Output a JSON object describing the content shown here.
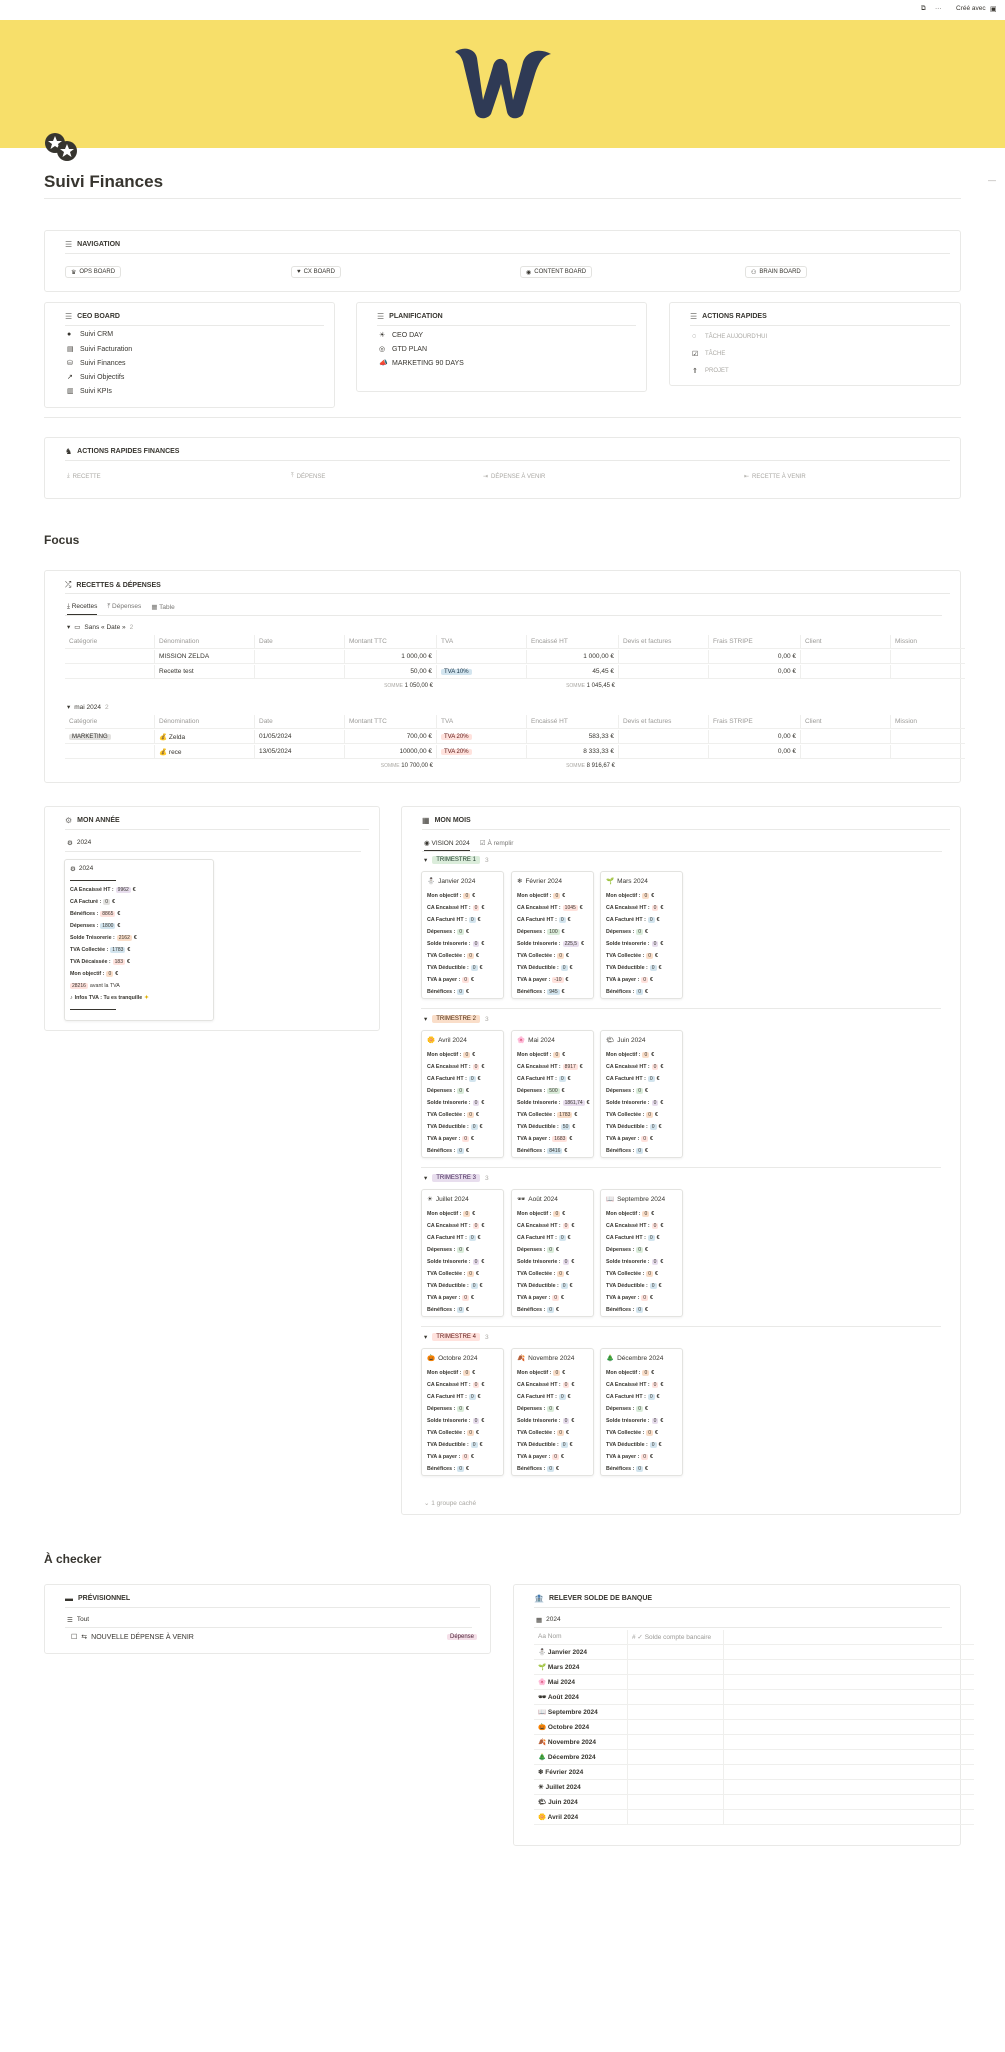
{
  "topbar": {
    "created_with": "Créé avec",
    "more": "···"
  },
  "page": {
    "title": "Suivi Finances"
  },
  "navigation": {
    "title": "NAVIGATION",
    "buttons": [
      {
        "icon": "crown",
        "label": "OPS BOARD"
      },
      {
        "icon": "heart",
        "label": "CX BOARD"
      },
      {
        "icon": "palette",
        "label": "CONTENT BOARD"
      },
      {
        "icon": "brain",
        "label": "BRAIN BOARD"
      }
    ]
  },
  "ceo_board": {
    "title": "CEO BOARD",
    "items": [
      "Suivi CRM",
      "Suivi Facturation",
      "Suivi Finances",
      "Suivi Objectifs",
      "Suivi KPIs"
    ]
  },
  "planification": {
    "title": "PLANIFICATION",
    "items": [
      "CEO DAY",
      "GTD PLAN",
      "MARKETING 90 DAYS"
    ]
  },
  "actions_rapides": {
    "title": "ACTIONS RAPIDES",
    "items": [
      "TÂCHE AUJOURD'HUI",
      "TÂCHE",
      "PROJET"
    ]
  },
  "actions_finances": {
    "title": "ACTIONS RAPIDES FINANCES",
    "items": [
      "RECETTE",
      "DÉPENSE",
      "DÉPENSE À VENIR",
      "RECETTE À VENIR"
    ]
  },
  "focus": {
    "title": "Focus",
    "db_title": "RECETTES & DÉPENSES",
    "tabs": [
      "Recettes",
      "Dépenses",
      "Table"
    ],
    "columns": [
      "Catégorie",
      "Dénomination",
      "Date",
      "Montant TTC",
      "TVA",
      "Encaissé HT",
      "Devis et factures",
      "Frais STRIPE",
      "Client",
      "Mission"
    ],
    "groups": [
      {
        "name": "Sans « Date »",
        "count": "2",
        "rows": [
          {
            "cat": "",
            "name": "MISSION ZELDA",
            "date": "",
            "ttc": "1 000,00 €",
            "tva": "",
            "ht": "1 000,00 €",
            "stripe": "0,00 €"
          },
          {
            "cat": "",
            "name": "Recette test",
            "date": "",
            "ttc": "50,00 €",
            "tva": "TVA 10%",
            "ht": "45,45 €",
            "stripe": "0,00 €"
          }
        ],
        "sum_label": "SOMME",
        "sum_ttc": "1 050,00 €",
        "sum_ht": "1 045,45 €"
      },
      {
        "name": "mai 2024",
        "count": "2",
        "rows": [
          {
            "cat": "MARKETING",
            "name": "Zelda",
            "date": "01/05/2024",
            "ttc": "700,00 €",
            "tva": "TVA 20%",
            "ht": "583,33 €",
            "stripe": "0,00 €"
          },
          {
            "cat": "",
            "name": "rece",
            "date": "13/05/2024",
            "ttc": "10000,00 €",
            "tva": "TVA 20%",
            "ht": "8 333,33 €",
            "stripe": "0,00 €"
          }
        ],
        "sum_label": "SOMME",
        "sum_ttc": "10 700,00 €",
        "sum_ht": "8 916,67 €"
      }
    ]
  },
  "mon_annee": {
    "title": "MON ANNÉE",
    "view": "2024",
    "card_title": "2024",
    "rows": [
      {
        "label": "CA Encaissé HT :",
        "value": "9962",
        "unit": "€"
      },
      {
        "label": "CA Facturé :",
        "value": "0",
        "unit": "€"
      },
      {
        "label": "Bénéfices :",
        "value": "8865",
        "unit": "€"
      },
      {
        "label": "Dépenses :",
        "value": "1800",
        "unit": "€"
      },
      {
        "label": "Solde Trésorerie :",
        "value": "2162",
        "unit": "€"
      },
      {
        "label": "TVA Collectée :",
        "value": "1783",
        "unit": "€"
      },
      {
        "label": "TVA Décaissée :",
        "value": "183",
        "unit": "€"
      },
      {
        "label": "Mon objectif :",
        "value": "0",
        "unit": "€"
      },
      {
        "label": "avant la TVA",
        "value": "28216",
        "unit": ""
      },
      {
        "label": "Infos TVA : Tu es tranquille",
        "value": "",
        "unit": ""
      }
    ]
  },
  "mon_mois": {
    "title": "MON MOIS",
    "tabs": [
      "VISION 2024",
      "À remplir"
    ],
    "row_labels": [
      "Mon objectif :",
      "CA Encaissé HT :",
      "CA Facturé HT :",
      "Dépenses :",
      "Solde trésorerie :",
      "TVA Collectée :",
      "TVA Déductible :",
      "TVA à payer :",
      "Bénéfices :"
    ],
    "trimestres": [
      {
        "name": "TRIMESTRE 1",
        "count": "3",
        "color": "#dbeddb",
        "text": "#1c3829",
        "months": [
          {
            "icon": "⛄",
            "name": "Janvier 2024",
            "values": [
              "0",
              "0",
              "0",
              "0",
              "0",
              "0",
              "0",
              "0",
              "0"
            ]
          },
          {
            "icon": "❄",
            "name": "Février 2024",
            "values": [
              "0",
              "1045",
              "0",
              "100",
              "225,5",
              "0",
              "0",
              "-10",
              "945"
            ]
          },
          {
            "icon": "🌱",
            "name": "Mars 2024",
            "values": [
              "0",
              "0",
              "0",
              "0",
              "0",
              "0",
              "0",
              "0",
              "0"
            ]
          }
        ]
      },
      {
        "name": "TRIMESTRE 2",
        "count": "3",
        "color": "#fadec9",
        "text": "#49290e",
        "months": [
          {
            "icon": "🌼",
            "name": "Avril 2024",
            "values": [
              "0",
              "0",
              "0",
              "0",
              "0",
              "0",
              "0",
              "0",
              "0"
            ]
          },
          {
            "icon": "🌸",
            "name": "Mai 2024",
            "values": [
              "0",
              "8917",
              "0",
              "500",
              "1861,74",
              "1783",
              "50",
              "1683",
              "8416"
            ]
          },
          {
            "icon": "🌤",
            "name": "Juin 2024",
            "values": [
              "0",
              "0",
              "0",
              "0",
              "0",
              "0",
              "0",
              "0",
              "0"
            ]
          }
        ]
      },
      {
        "name": "TRIMESTRE 3",
        "count": "3",
        "color": "#e8deee",
        "text": "#412454",
        "months": [
          {
            "icon": "☀",
            "name": "Juillet 2024",
            "values": [
              "0",
              "0",
              "0",
              "0",
              "0",
              "0",
              "0",
              "0",
              "0"
            ]
          },
          {
            "icon": "🕶",
            "name": "Août 2024",
            "values": [
              "0",
              "0",
              "0",
              "0",
              "0",
              "0",
              "0",
              "0",
              "0"
            ]
          },
          {
            "icon": "📖",
            "name": "Septembre 2024",
            "values": [
              "0",
              "0",
              "0",
              "0",
              "0",
              "0",
              "0",
              "0",
              "0"
            ]
          }
        ]
      },
      {
        "name": "TRIMESTRE 4",
        "count": "3",
        "color": "#ffe2dd",
        "text": "#5d1715",
        "months": [
          {
            "icon": "🎃",
            "name": "Octobre 2024",
            "values": [
              "0",
              "0",
              "0",
              "0",
              "0",
              "0",
              "0",
              "0",
              "0"
            ]
          },
          {
            "icon": "🍂",
            "name": "Novembre 2024",
            "values": [
              "0",
              "0",
              "0",
              "0",
              "0",
              "0",
              "0",
              "0",
              "0"
            ]
          },
          {
            "icon": "🎄",
            "name": "Décembre 2024",
            "values": [
              "0",
              "0",
              "0",
              "0",
              "0",
              "0",
              "0",
              "0",
              "0"
            ]
          }
        ]
      }
    ],
    "hidden_groups": "1 groupe caché"
  },
  "a_checker": {
    "title": "À checker",
    "previsionnel": {
      "title": "PRÉVISIONNEL",
      "view": "Tout",
      "item": "NOUVELLE DÉPENSE À VENIR",
      "tag": "Dépense"
    },
    "releve": {
      "title": "RELEVER SOLDE DE BANQUE",
      "view": "2024",
      "col_name": "Nom",
      "col_solde": "Solde compte bancaire",
      "rows": [
        {
          "icon": "⛄",
          "name": "Janvier 2024"
        },
        {
          "icon": "🌱",
          "name": "Mars 2024"
        },
        {
          "icon": "🌸",
          "name": "Mai 2024"
        },
        {
          "icon": "🕶",
          "name": "Août 2024"
        },
        {
          "icon": "📖",
          "name": "Septembre 2024"
        },
        {
          "icon": "🎃",
          "name": "Octobre 2024"
        },
        {
          "icon": "🍂",
          "name": "Novembre 2024"
        },
        {
          "icon": "🎄",
          "name": "Décembre 2024"
        },
        {
          "icon": "❄",
          "name": "Février 2024"
        },
        {
          "icon": "☀",
          "name": "Juillet 2024"
        },
        {
          "icon": "🌤",
          "name": "Juin 2024"
        },
        {
          "icon": "🌼",
          "name": "Avril 2024"
        }
      ]
    }
  },
  "colors": {
    "cover": "#f7df6a",
    "logo": "#2f3a55"
  }
}
